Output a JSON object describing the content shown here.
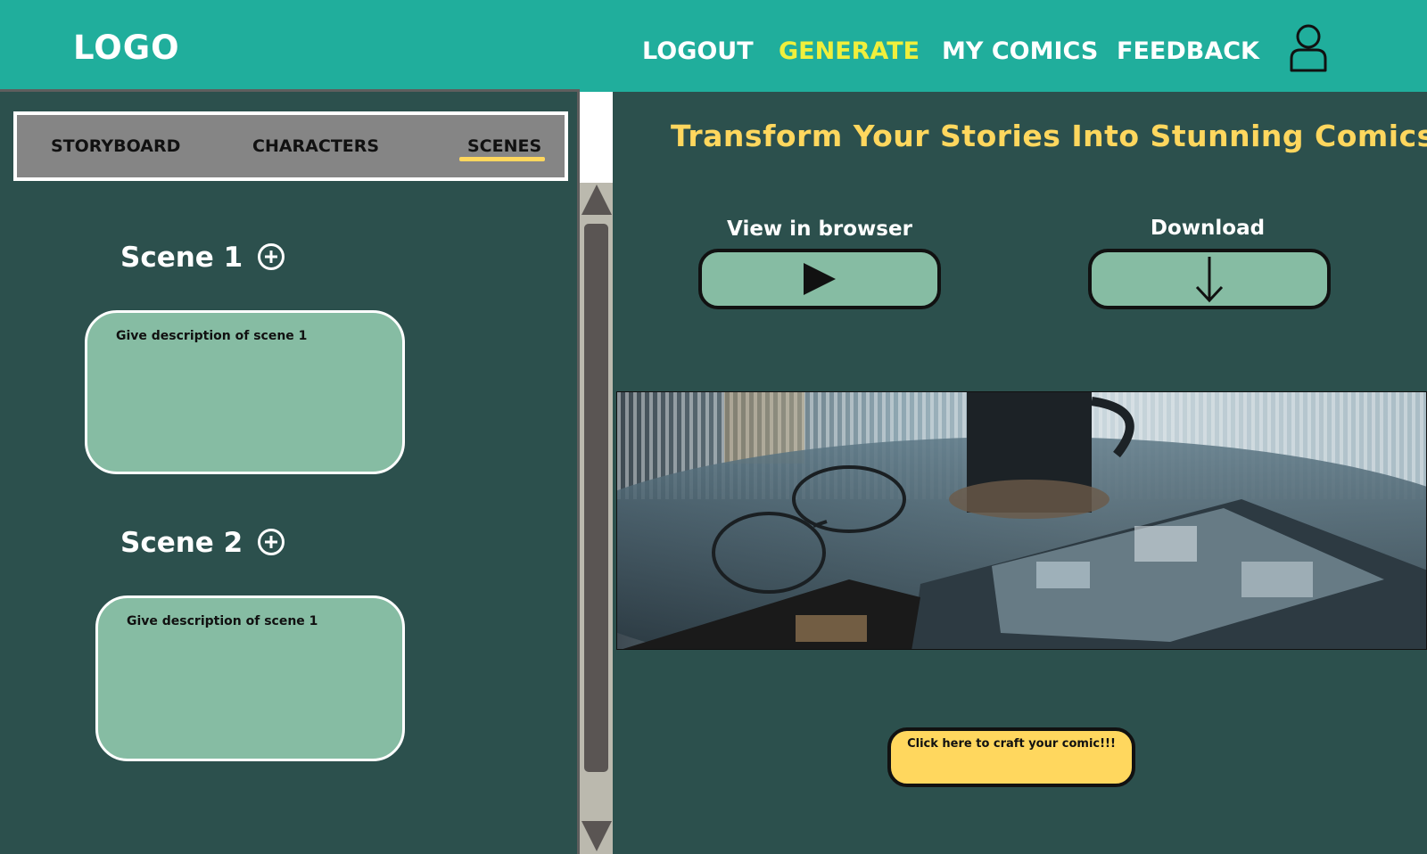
{
  "header": {
    "logo": "LOGO",
    "nav": {
      "logout": "LOGOUT",
      "generate": "GENERATE",
      "my_comics": "MY COMICS",
      "feedback": "FEEDBACK"
    },
    "active_nav_color": "#f0ef3c",
    "background_color": "#20ae9c",
    "user_icon": "user-profile-icon"
  },
  "sidebar": {
    "tabs": {
      "storyboard": "STORYBOARD",
      "characters": "CHARACTERS",
      "scenes": "SCENES"
    },
    "active_tab": "SCENES",
    "scenes": [
      {
        "title": "Scene 1",
        "placeholder": "Give description of scene 1"
      },
      {
        "title": "Scene 2",
        "placeholder": "Give description of scene 1"
      }
    ],
    "add_icon": "plus-circle-icon"
  },
  "main": {
    "title": "Transform Your Stories Into Stunning Comics!!!",
    "view_label": "View in browser",
    "view_icon": "play-icon",
    "download_label": "Download",
    "download_icon": "arrow-down-icon",
    "preview_image": "comic book, glasses and mug on glass table",
    "craft_button": "Click here to craft your comic!!!"
  },
  "colors": {
    "panel": "#2c504d",
    "accent_yellow": "#ffd75e",
    "field_green": "#86bca3"
  }
}
